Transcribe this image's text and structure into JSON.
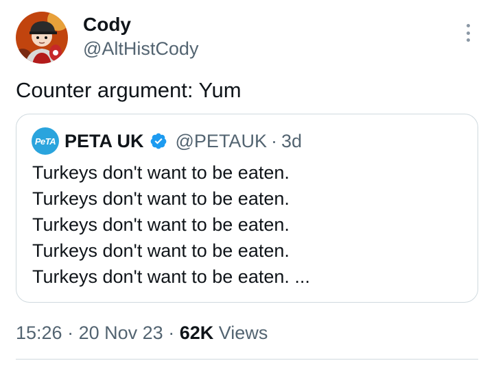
{
  "tweet": {
    "author": {
      "name": "Cody",
      "handle": "@AltHistCody",
      "avatar_icon": "cartoon-avatar-icon"
    },
    "text": "Counter argument: Yum",
    "more_icon": "more-options-icon"
  },
  "quote": {
    "author": {
      "name": "PETA UK",
      "handle": "@PETAUK",
      "logo_text": "PeTA",
      "verified_icon": "verified-badge-icon"
    },
    "separator": "·",
    "time": "3d",
    "lines": [
      "Turkeys don't want to be eaten.",
      "Turkeys don't want to be eaten.",
      "Turkeys don't want to be eaten.",
      "Turkeys don't want to be eaten.",
      "Turkeys don't want to be eaten. ..."
    ]
  },
  "meta": {
    "time": "15:26",
    "separator": "·",
    "date": "20 Nov 23",
    "views_count": "62K",
    "views_label": "Views"
  },
  "colors": {
    "text": "#0f1419",
    "secondary": "#536471",
    "verified": "#1d9bf0",
    "border": "#cfd9de"
  }
}
